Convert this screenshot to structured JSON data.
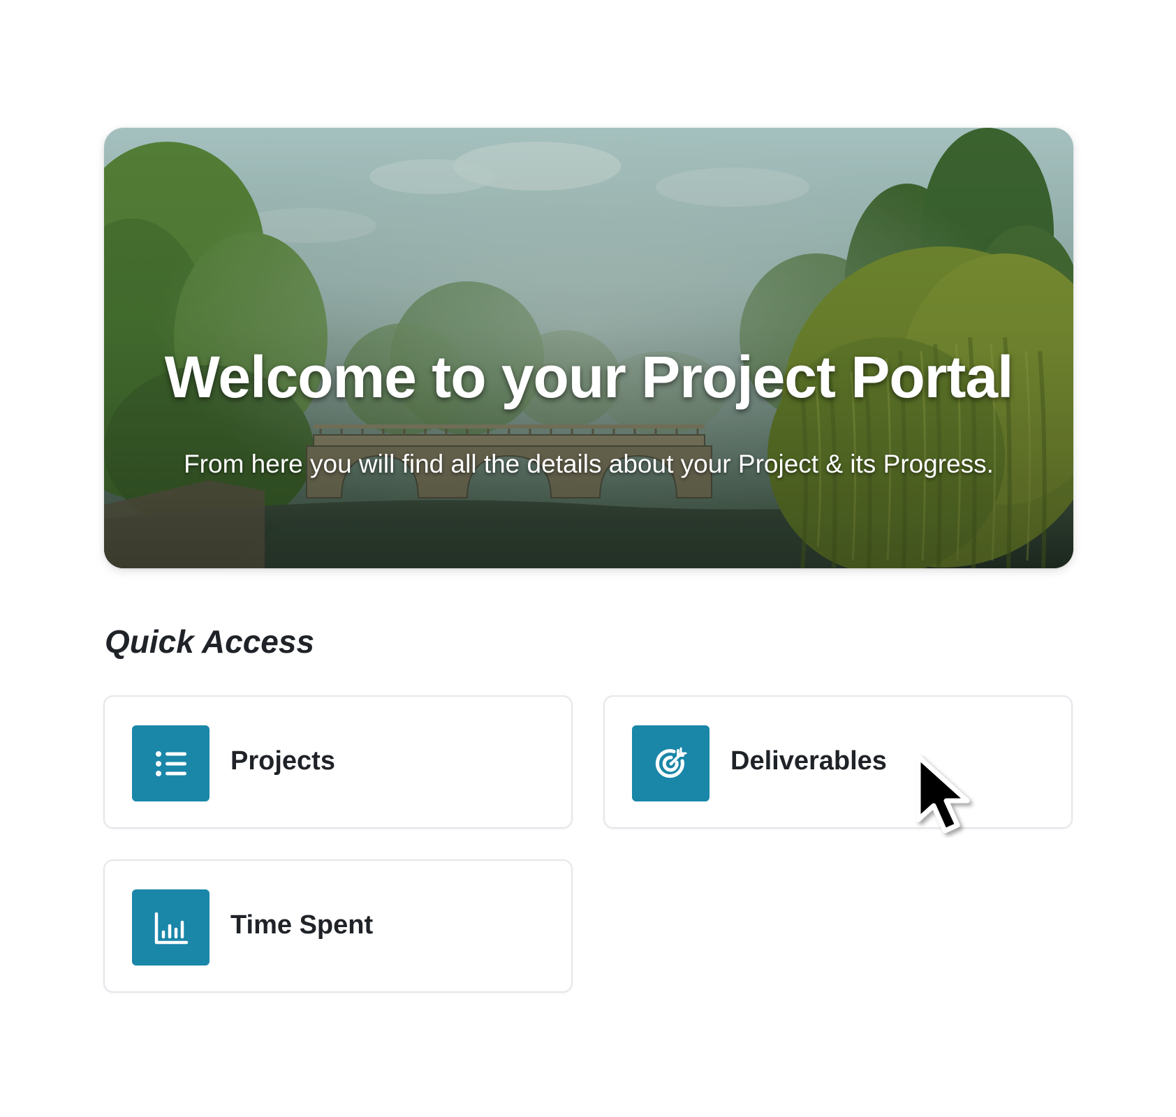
{
  "hero": {
    "title": "Welcome to your Project Portal",
    "subtitle": "From here you will find all the details about your Project & its Progress.",
    "image": "painted landscape: stone arched bridge over a river with willow trees"
  },
  "quick_access": {
    "title": "Quick Access",
    "cards": [
      {
        "label": "Projects",
        "icon": "list-icon"
      },
      {
        "label": "Deliverables",
        "icon": "target-icon"
      },
      {
        "label": "Time Spent",
        "icon": "bar-chart-icon"
      }
    ]
  },
  "colors": {
    "accent": "#1a86a8",
    "text": "#1f2328",
    "card_border": "#e4e6ea",
    "background": "#ffffff"
  },
  "cursor": {
    "icon": "mouse-pointer-icon"
  }
}
